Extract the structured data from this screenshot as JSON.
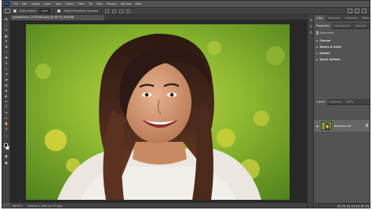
{
  "app": {
    "logo": "Ps"
  },
  "menu": [
    "File",
    "Edit",
    "Image",
    "Layer",
    "Type",
    "Select",
    "Filter",
    "3D",
    "View",
    "Plugins",
    "Window",
    "Help"
  ],
  "options": {
    "auto_select_label": "Auto-Select:",
    "auto_select_value": "Layer",
    "transform_label": "Show Transform Controls"
  },
  "document": {
    "tab_title": "AdobeStock_1072068.jpeg @ 66.7% (RGB/8)",
    "status": {
      "zoom": "66.67%",
      "info": "3000 px x 2000 px (72 ppi)"
    }
  },
  "panels": {
    "top_tabs": [
      "Color",
      "Swatches",
      "Gradients",
      "Patterns"
    ],
    "props_tabs": [
      "Properties",
      "Adjustments",
      "Libraries"
    ],
    "props_doc_label": "Document",
    "sections": [
      "Canvas",
      "Rulers & Grids",
      "Guides",
      "Quick Actions"
    ],
    "layers_tabs": [
      "Layers",
      "Channels",
      "Paths"
    ],
    "layer_name": "Background"
  },
  "colors": {
    "ui_dark": "#535353",
    "ui_darker": "#424242",
    "canvas_bg": "#282828",
    "active_layer": "#666666"
  },
  "icons": {
    "tools": [
      "move-tool",
      "artboard-tool",
      "marquee-tool",
      "lasso-tool",
      "object-select-tool",
      "crop-tool",
      "frame-tool",
      "eyedropper-tool",
      "healing-brush-tool",
      "brush-tool",
      "clone-stamp-tool",
      "history-brush-tool",
      "eraser-tool",
      "gradient-tool",
      "blur-tool",
      "dodge-tool",
      "pen-tool",
      "type-tool",
      "path-select-tool",
      "rectangle-tool",
      "hand-tool",
      "zoom-tool"
    ]
  }
}
